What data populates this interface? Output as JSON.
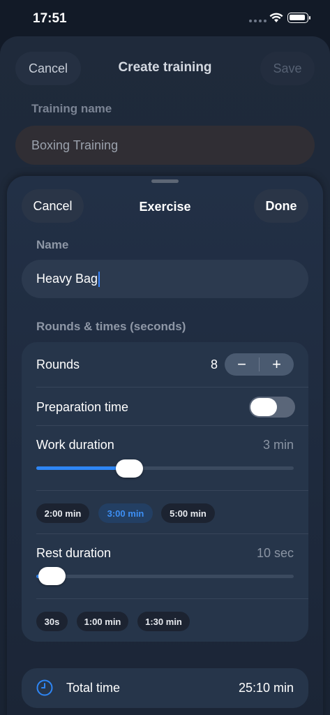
{
  "status_bar": {
    "time": "17:51"
  },
  "outer": {
    "cancel_label": "Cancel",
    "title": "Create training",
    "save_label": "Save",
    "training_name_label": "Training name",
    "training_name_value": "Boxing Training"
  },
  "exercise": {
    "cancel_label": "Cancel",
    "title": "Exercise",
    "done_label": "Done",
    "name_label": "Name",
    "name_value": "Heavy Bag",
    "rounds_section_label": "Rounds & times (seconds)",
    "rounds": {
      "label": "Rounds",
      "value": "8",
      "decrement": "−",
      "increment": "+"
    },
    "preparation": {
      "label": "Preparation time",
      "enabled": false
    },
    "work": {
      "label": "Work duration",
      "value": "3 min",
      "slider_fraction": 0.32,
      "presets": [
        "2:00 min",
        "3:00 min",
        "5:00 min"
      ],
      "selected_preset": "3:00 min"
    },
    "rest": {
      "label": "Rest duration",
      "value": "10 sec",
      "slider_fraction": 0.02,
      "presets": [
        "30s",
        "1:00 min",
        "1:30 min"
      ]
    },
    "total": {
      "label": "Total time",
      "value": "25:10 min",
      "icon": "clock-icon"
    }
  },
  "colors": {
    "accent": "#2e86f5",
    "background": "#121a27",
    "card": "#26354a"
  }
}
